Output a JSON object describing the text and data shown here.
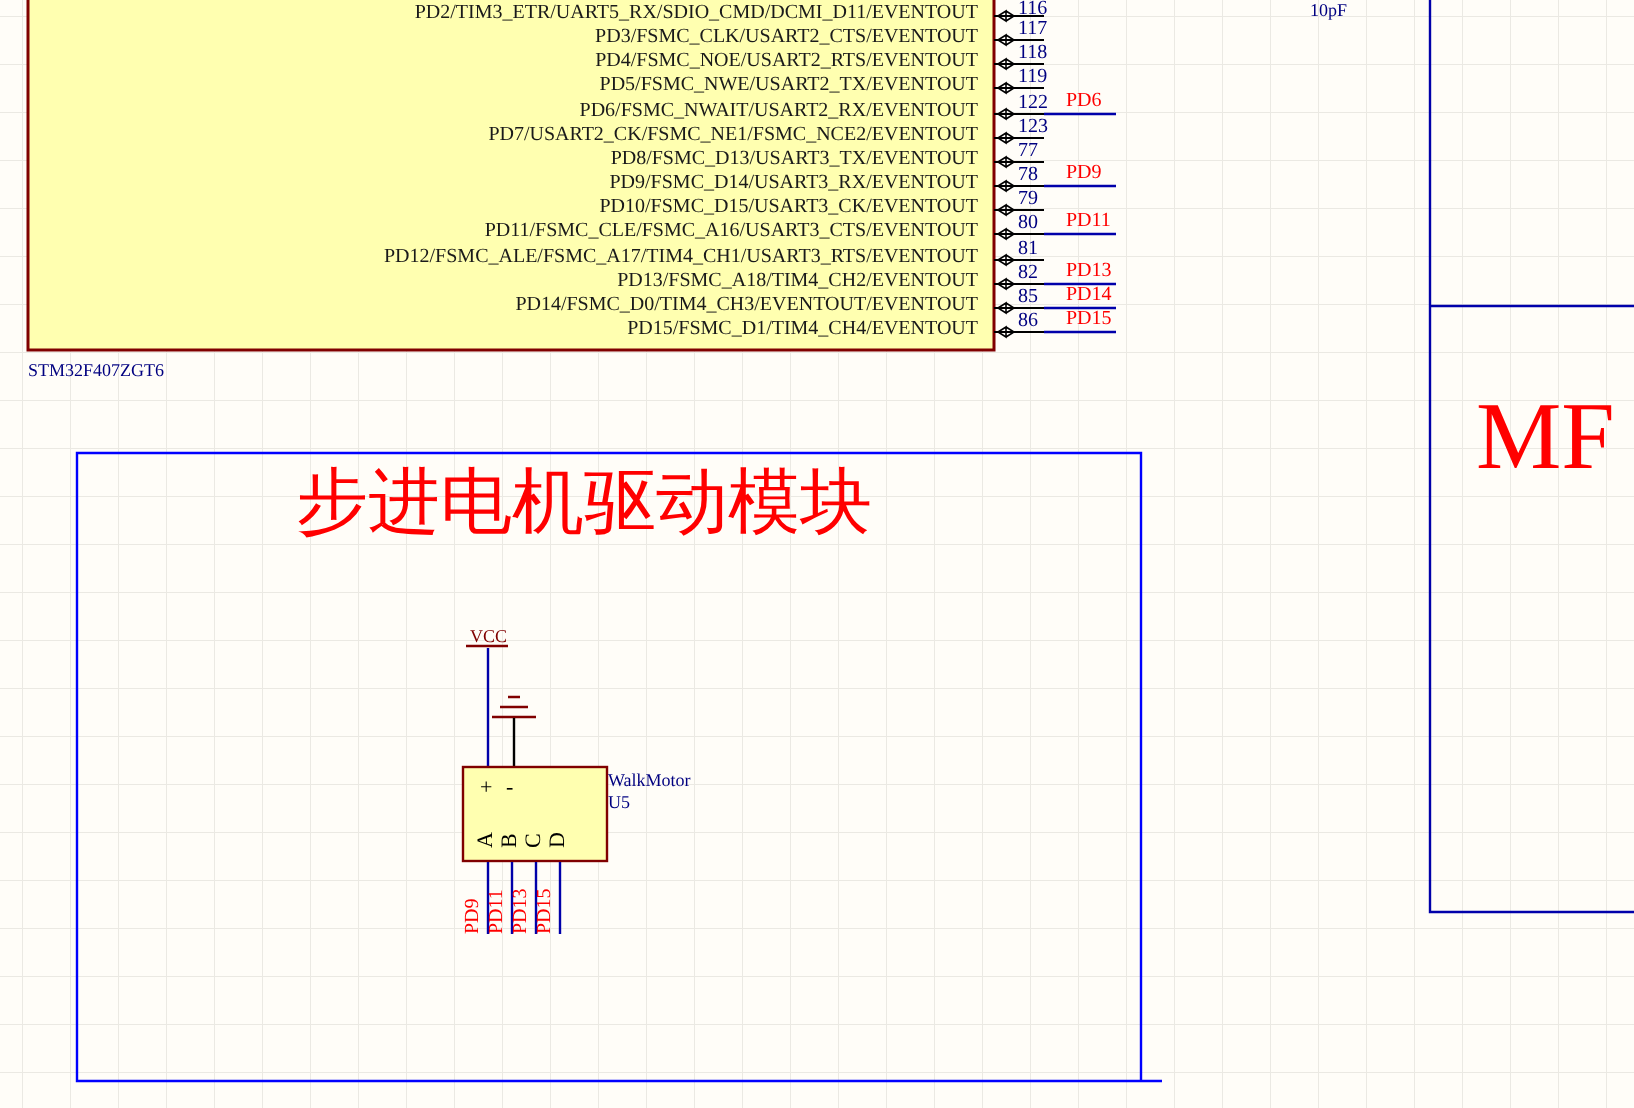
{
  "chip": {
    "part": "STM32F407ZGT6",
    "pins": [
      {
        "name": "PD2/TIM3_ETR/UART5_RX/SDIO_CMD/DCMI_D11/EVENTOUT",
        "number": "116"
      },
      {
        "name": "PD3/FSMC_CLK/USART2_CTS/EVENTOUT",
        "number": "117"
      },
      {
        "name": "PD4/FSMC_NOE/USART2_RTS/EVENTOUT",
        "number": "118"
      },
      {
        "name": "PD5/FSMC_NWE/USART2_TX/EVENTOUT",
        "number": "119"
      },
      {
        "name": "PD6/FSMC_NWAIT/USART2_RX/EVENTOUT",
        "number": "122",
        "net": "PD6"
      },
      {
        "name": "PD7/USART2_CK/FSMC_NE1/FSMC_NCE2/EVENTOUT",
        "number": "123"
      },
      {
        "name": "PD8/FSMC_D13/USART3_TX/EVENTOUT",
        "number": "77"
      },
      {
        "name": "PD9/FSMC_D14/USART3_RX/EVENTOUT",
        "number": "78",
        "net": "PD9"
      },
      {
        "name": "PD10/FSMC_D15/USART3_CK/EVENTOUT",
        "number": "79"
      },
      {
        "name": "PD11/FSMC_CLE/FSMC_A16/USART3_CTS/EVENTOUT",
        "number": "80",
        "net": "PD11"
      },
      {
        "name": "PD12/FSMC_ALE/FSMC_A17/TIM4_CH1/USART3_RTS/EVENTOUT",
        "number": "81"
      },
      {
        "name": "PD13/FSMC_A18/TIM4_CH2/EVENTOUT",
        "number": "82",
        "net": "PD13"
      },
      {
        "name": "PD14/FSMC_D0/TIM4_CH3/EVENTOUT/EVENTOUT",
        "number": "85",
        "net": "PD14"
      },
      {
        "name": "PD15/FSMC_D1/TIM4_CH4/EVENTOUT",
        "number": "86",
        "net": "PD15"
      }
    ]
  },
  "capacitor_value": "10pF",
  "sheet_label": "MF",
  "module": {
    "title": "步进电机驱动模块",
    "power_label": "VCC",
    "component": {
      "comment": "WalkMotor",
      "designator": "U5",
      "pins_top": [
        "+",
        "-"
      ],
      "pins_bottom": [
        {
          "label": "A",
          "net": "PD9"
        },
        {
          "label": "B",
          "net": "PD11"
        },
        {
          "label": "C",
          "net": "PD13"
        },
        {
          "label": "D",
          "net": "PD15"
        }
      ]
    }
  }
}
